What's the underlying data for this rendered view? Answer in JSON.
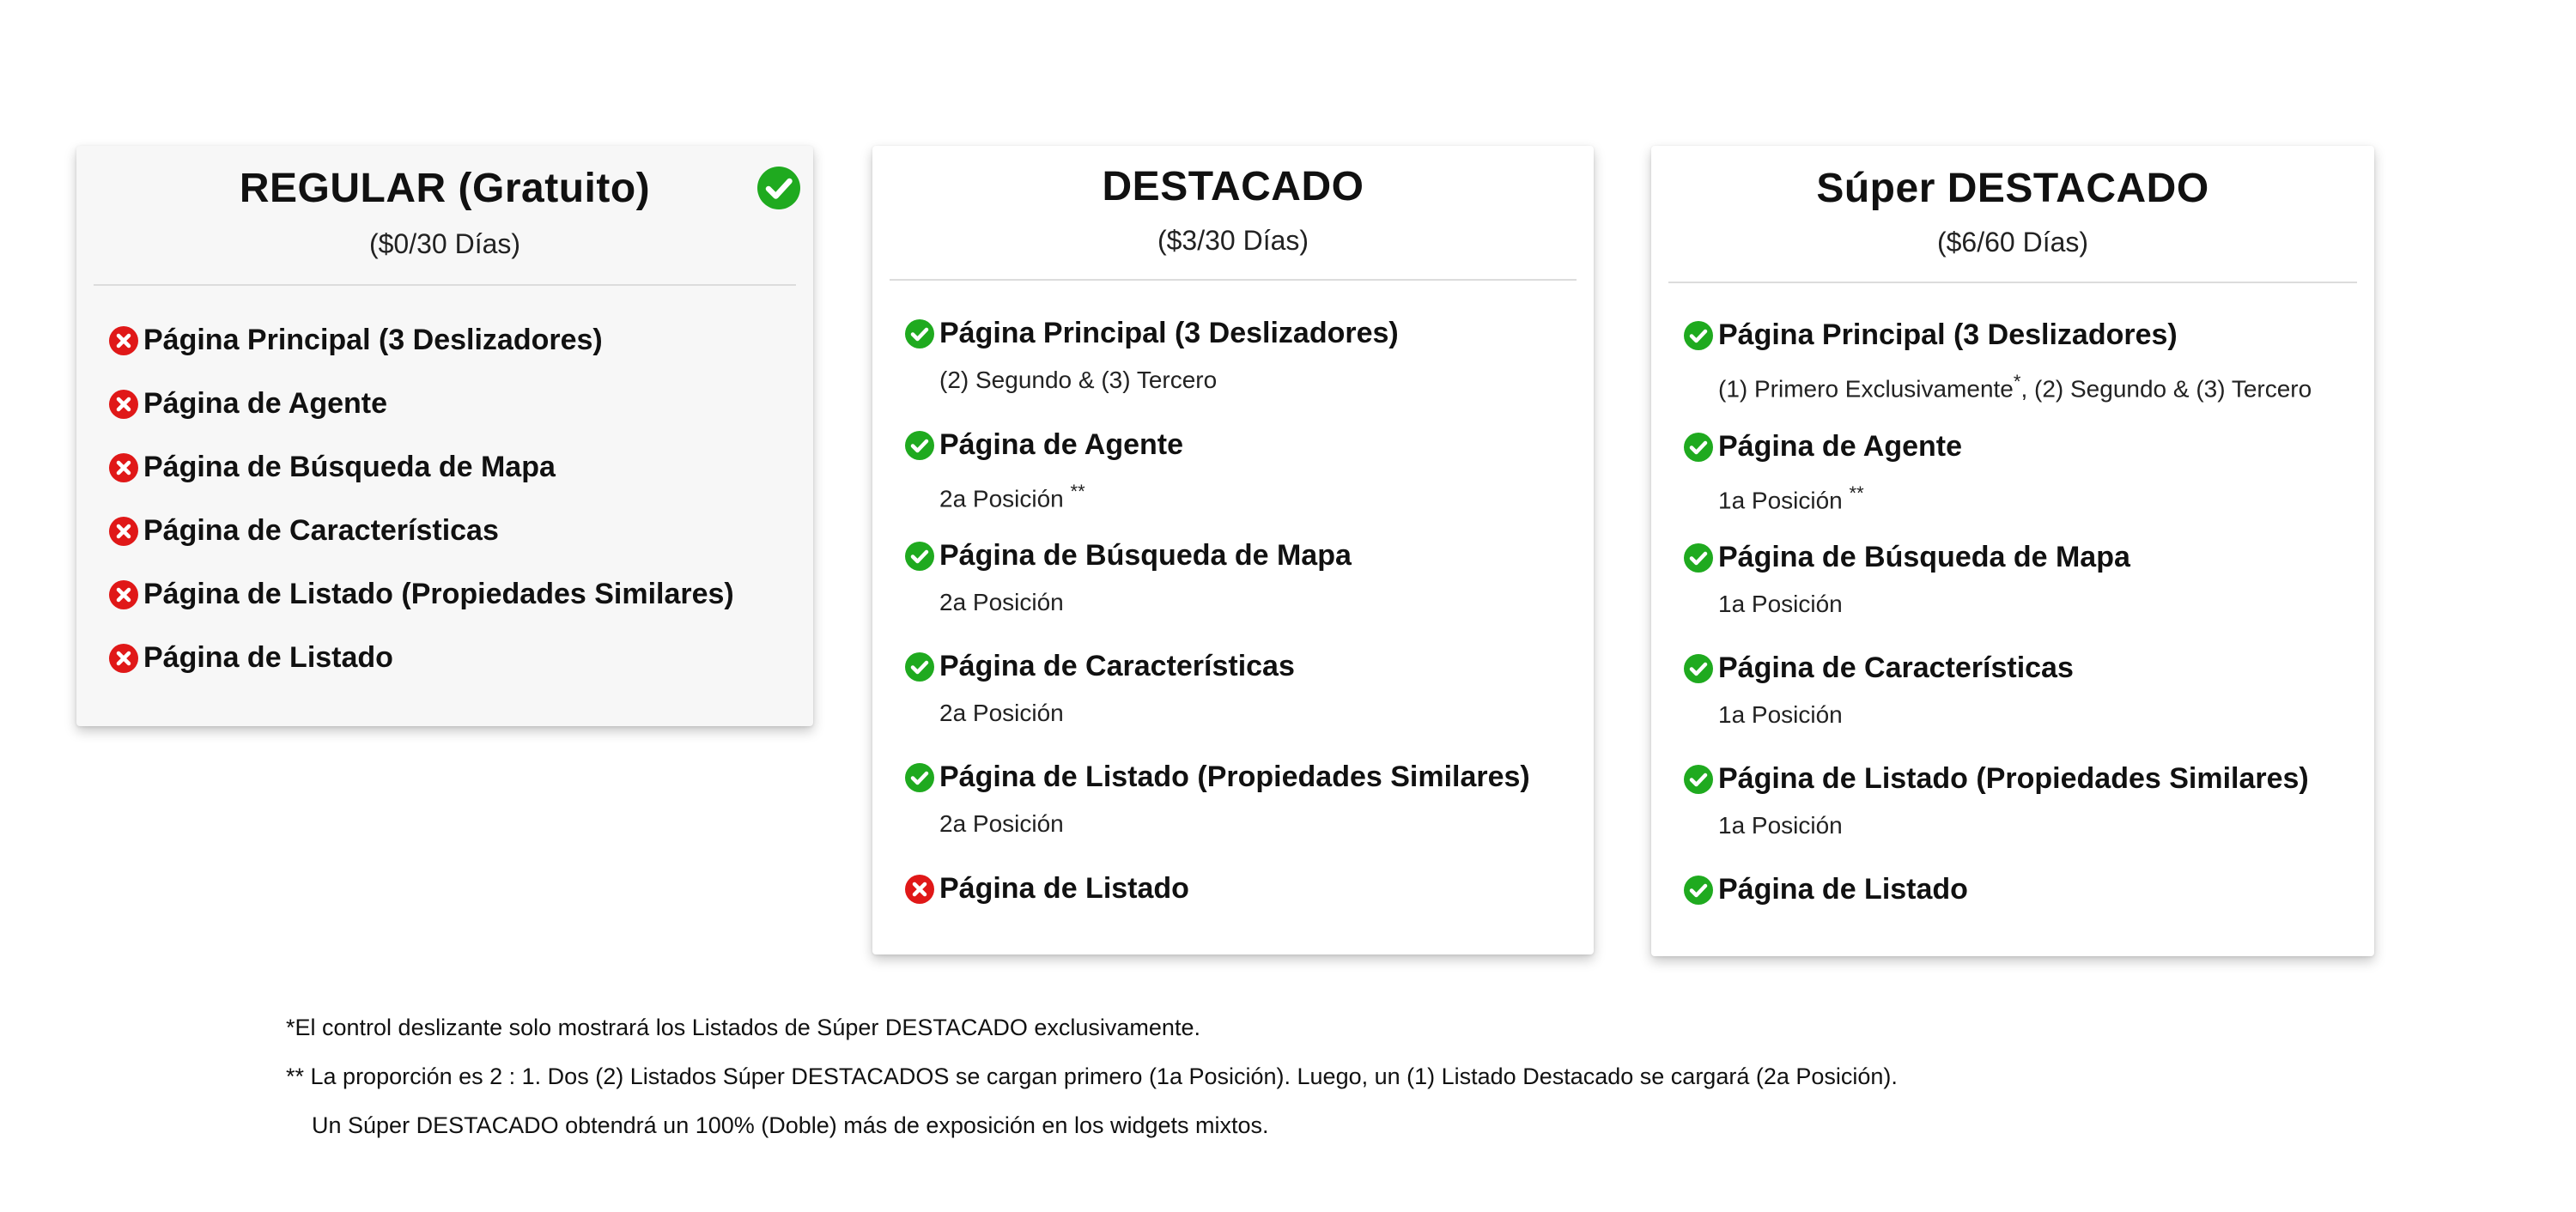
{
  "colors": {
    "check": "#1faa1f",
    "cross": "#e01818"
  },
  "plans": [
    {
      "title": "REGULAR (Gratuito)",
      "price": "($0/30 Días)",
      "selected": true,
      "selected_icon": "check-circle-icon",
      "features": [
        {
          "included": false,
          "icon": "x-circle-icon",
          "label": "Página Principal (3 Deslizadores)"
        },
        {
          "included": false,
          "icon": "x-circle-icon",
          "label": "Página de Agente"
        },
        {
          "included": false,
          "icon": "x-circle-icon",
          "label": "Página de Búsqueda de Mapa"
        },
        {
          "included": false,
          "icon": "x-circle-icon",
          "label": "Página de Características"
        },
        {
          "included": false,
          "icon": "x-circle-icon",
          "label": "Página de Listado (Propiedades Similares)"
        },
        {
          "included": false,
          "icon": "x-circle-icon",
          "label": "Página de Listado"
        }
      ]
    },
    {
      "title": "DESTACADO",
      "price": "($3/30 Días)",
      "features": [
        {
          "included": true,
          "icon": "check-circle-icon",
          "label": "Página Principal (3 Deslizadores)",
          "detail": "(2) Segundo & (3) Tercero"
        },
        {
          "included": true,
          "icon": "check-circle-icon",
          "label": "Página de Agente",
          "detail": "2a Posición",
          "note": "**"
        },
        {
          "included": true,
          "icon": "check-circle-icon",
          "label": "Página de Búsqueda de Mapa",
          "detail": "2a Posición"
        },
        {
          "included": true,
          "icon": "check-circle-icon",
          "label": "Página de Características",
          "detail": "2a Posición"
        },
        {
          "included": true,
          "icon": "check-circle-icon",
          "label": "Página de Listado (Propiedades Similares)",
          "detail": "2a Posición"
        },
        {
          "included": false,
          "icon": "x-circle-icon",
          "label": "Página de Listado"
        }
      ]
    },
    {
      "title": "Súper DESTACADO",
      "price": "($6/60 Días)",
      "features": [
        {
          "included": true,
          "icon": "check-circle-icon",
          "label": "Página Principal (3 Deslizadores)",
          "detail_a": "(1) Primero Exclusivamente",
          "detail_note": "*",
          "detail_b": ", (2) Segundo & (3) Tercero"
        },
        {
          "included": true,
          "icon": "check-circle-icon",
          "label": "Página de Agente",
          "detail": "1a Posición",
          "note": "**"
        },
        {
          "included": true,
          "icon": "check-circle-icon",
          "label": "Página de Búsqueda de Mapa",
          "detail": "1a Posición"
        },
        {
          "included": true,
          "icon": "check-circle-icon",
          "label": "Página de Características",
          "detail": "1a Posición"
        },
        {
          "included": true,
          "icon": "check-circle-icon",
          "label": "Página de Listado (Propiedades Similares)",
          "detail": "1a Posición"
        },
        {
          "included": true,
          "icon": "check-circle-icon",
          "label": "Página de Listado"
        }
      ]
    }
  ],
  "footnotes": [
    "*El control deslizante solo mostrará los Listados de Súper DESTACADO exclusivamente.",
    "** La proporción es 2 : 1. Dos (2) Listados Súper DESTACADOS se cargan primero (1a Posición). Luego, un (1) Listado Destacado se cargará (2a Posición).",
    "Un Súper DESTACADO obtendrá un 100% (Doble) más de exposición en los widgets mixtos."
  ]
}
